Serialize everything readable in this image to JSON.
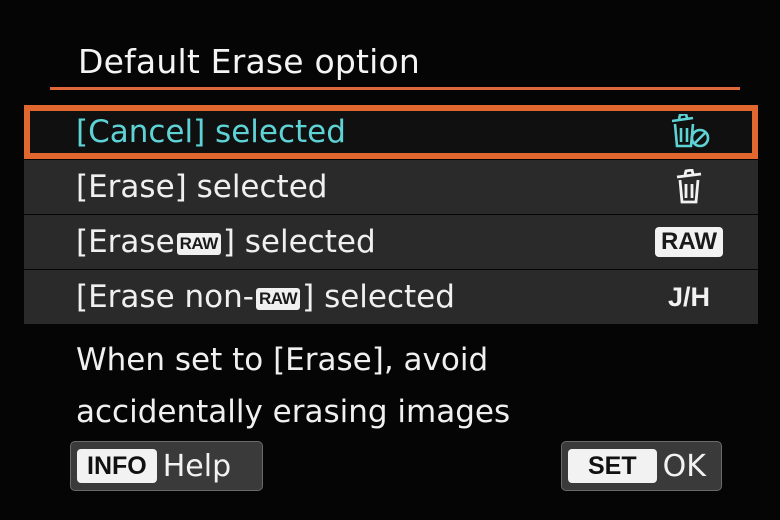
{
  "title": "Default Erase option",
  "menu": [
    {
      "prefix": "[Cancel] selected",
      "tag": "",
      "suffix": "",
      "icon": "erase-cancel-icon",
      "right_text": ""
    },
    {
      "prefix": "[Erase] selected",
      "tag": "",
      "suffix": "",
      "icon": "trash-icon",
      "right_text": ""
    },
    {
      "prefix": "[Erase",
      "tag": "RAW",
      "suffix": "] selected",
      "icon": "",
      "right_text": "RAW"
    },
    {
      "prefix": "[Erase non-",
      "tag": "RAW",
      "suffix": "] selected",
      "icon": "",
      "right_text": "J/H"
    }
  ],
  "selected_index": 0,
  "help_text": {
    "line1": "When set to [Erase], avoid",
    "line2": "accidentally erasing images"
  },
  "buttons": {
    "info_key": "INFO",
    "info_label": "Help",
    "set_key": "SET",
    "ok_label": "OK"
  },
  "colors": {
    "accent": "#e0682f",
    "selected_text": "#5ed3d6",
    "row_bg": "#2a2a2a"
  }
}
